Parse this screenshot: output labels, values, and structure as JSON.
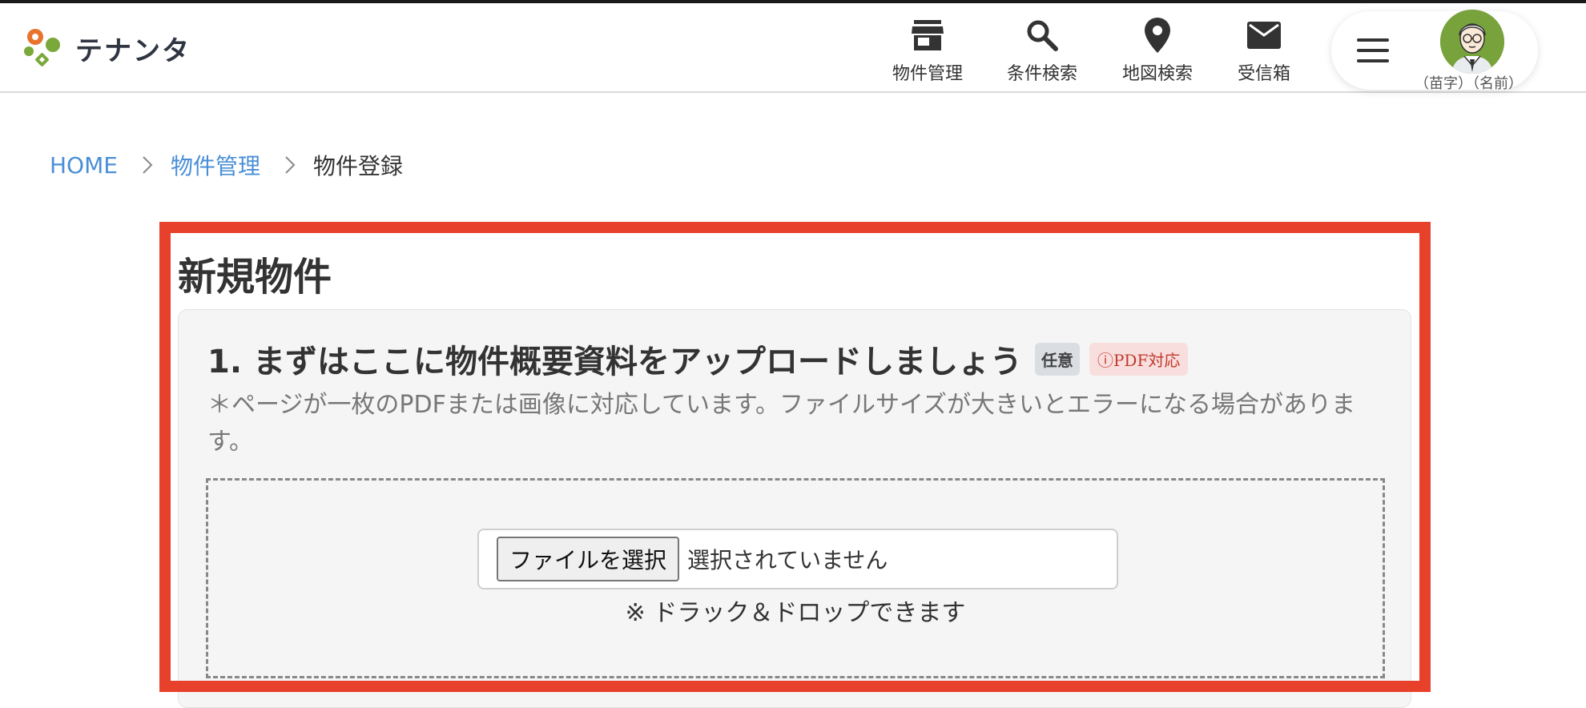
{
  "app": {
    "logo_text": "テナンタ"
  },
  "nav": {
    "items": [
      {
        "label": "物件管理",
        "icon": "store-icon"
      },
      {
        "label": "条件検索",
        "icon": "search-icon"
      },
      {
        "label": "地図検索",
        "icon": "map-pin-icon"
      },
      {
        "label": "受信箱",
        "icon": "mail-icon"
      }
    ]
  },
  "user": {
    "name": "（苗字）（名前）",
    "menu_icon": "hamburger-icon"
  },
  "breadcrumb": {
    "home": "HOME",
    "parent": "物件管理",
    "current": "物件登録"
  },
  "page": {
    "title": "新規物件"
  },
  "section": {
    "heading": "1. まずはここに物件概要資料をアップロードしましょう",
    "badge_optional": "任意",
    "badge_pdf": "ⓘPDF対応",
    "note": "＊ページが一枚のPDFまたは画像に対応しています。ファイルサイズが大きいとエラーになる場合があります。",
    "file_button": "ファイルを選択",
    "file_status": "選択されていません",
    "drag_hint": "※ ドラック＆ドロップできます"
  },
  "colors": {
    "highlight": "#e8412b",
    "link": "#4a8fd6",
    "avatar_bg": "#78a23c"
  }
}
